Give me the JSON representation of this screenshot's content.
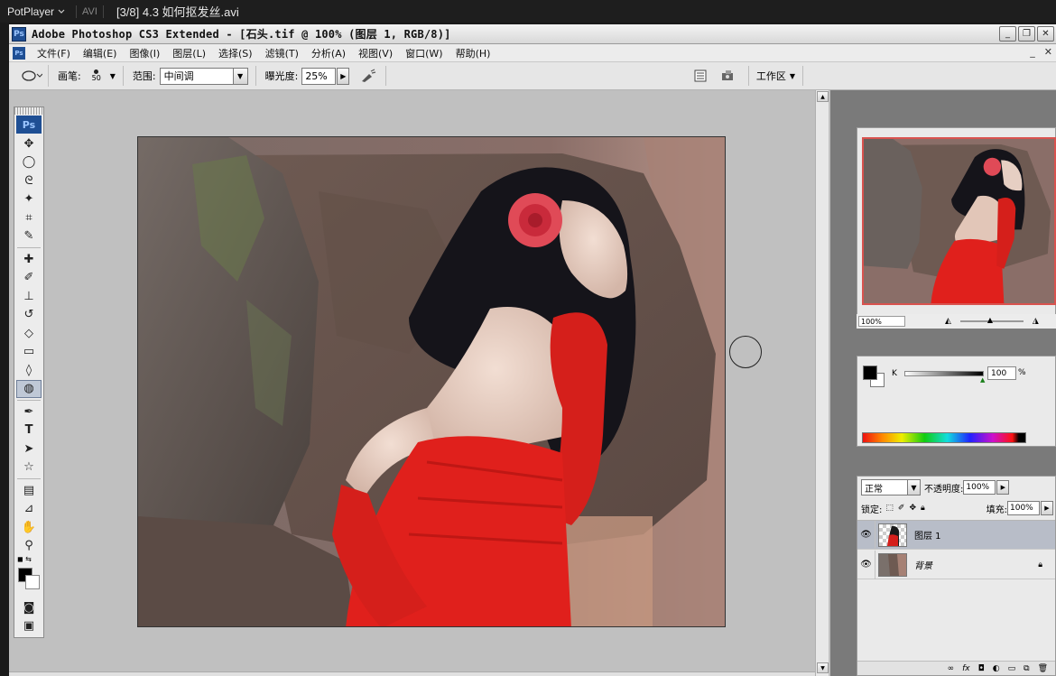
{
  "player": {
    "name": "PotPlayer",
    "format": "AVI",
    "file_title": "[3/8] 4.3 如何抠发丝.avi"
  },
  "photoshop": {
    "title": "Adobe Photoshop CS3 Extended - [石头.tif @ 100% (图层 1, RGB/8)]",
    "window_buttons": {
      "minimize": "_",
      "restore": "❐",
      "close": "✕"
    },
    "menu": [
      "文件(F)",
      "编辑(E)",
      "图像(I)",
      "图层(L)",
      "选择(S)",
      "滤镜(T)",
      "分析(A)",
      "视图(V)",
      "窗口(W)",
      "帮助(H)"
    ],
    "doc_buttons": {
      "minimize": "_",
      "close": "✕"
    }
  },
  "options": {
    "brush_label": "画笔:",
    "brush_size": "50",
    "range_label": "范围:",
    "range_value": "中间调",
    "exposure_label": "曝光度:",
    "exposure_value": "25%",
    "workspace_label": "工作区"
  },
  "toolbox": {
    "logo": "Ps"
  },
  "navigator": {
    "zoom": "100%"
  },
  "color_panel": {
    "channel": "K",
    "value": "100",
    "unit": "%",
    "k_percent": 100
  },
  "layers": {
    "blend_mode": "正常",
    "opacity_label": "不透明度:",
    "opacity_value": "100%",
    "lock_label": "锁定:",
    "fill_label": "填充:",
    "fill_value": "100%",
    "items": [
      {
        "name": "图层 1",
        "selected": true,
        "locked": false
      },
      {
        "name": "背景",
        "selected": false,
        "locked": true
      }
    ]
  },
  "colors": {
    "ps_blue": "#1f4f94",
    "dress_red": "#e0201c",
    "rock": "#5e544f"
  }
}
